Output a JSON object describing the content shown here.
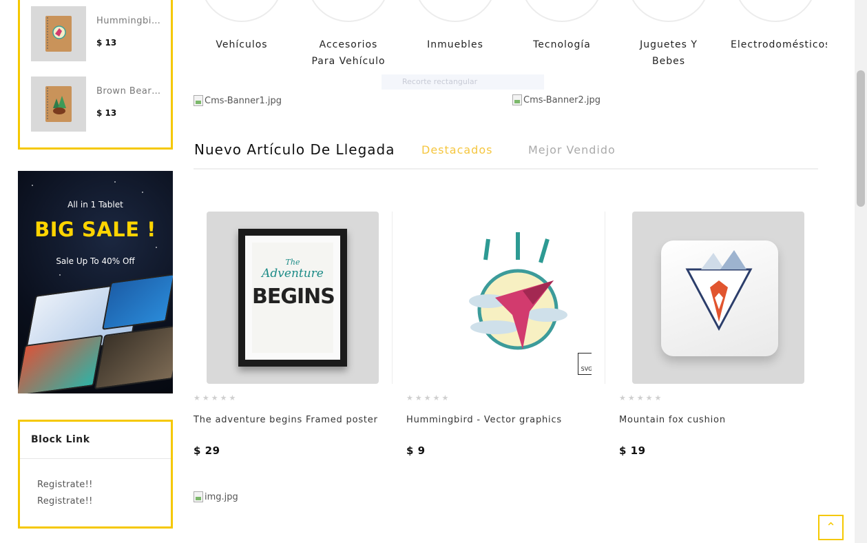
{
  "sidebar": {
    "mini_products": [
      {
        "name": "Hummingbird - Vector graphics",
        "price": "$ 13"
      },
      {
        "name": "Brown Bear - Vector graphics",
        "price": "$ 13"
      }
    ],
    "promo": {
      "kicker": "All in 1 Tablet",
      "title": "BIG SALE !",
      "subtitle": "Sale Up To 40% Off"
    },
    "block_link": {
      "title": "Block Link",
      "items": [
        "Registrate!!",
        "Registrate!!"
      ]
    }
  },
  "categories": [
    {
      "label": "Vehículos"
    },
    {
      "label": "Accesorios Para Vehículo"
    },
    {
      "label": "Inmuebles"
    },
    {
      "label": "Tecnología"
    },
    {
      "label": "Juguetes Y Bebes"
    },
    {
      "label": "Electrodomésticos"
    }
  ],
  "banners": {
    "banner1_alt": "Cms-Banner1.jpg",
    "banner2_alt": "Cms-Banner2.jpg",
    "bottom_alt": "img.jpg"
  },
  "faint_tool": "Recorte rectangular",
  "section": {
    "title": "Nuevo Artículo De Llegada",
    "tabs": [
      {
        "label": "Destacados",
        "color": "#f5c63f"
      },
      {
        "label": "Mejor Vendido",
        "color": "#aaaaaa"
      }
    ]
  },
  "products": [
    {
      "name": "The adventure begins Framed poster",
      "price": "$ 29",
      "stars": "★★★★★"
    },
    {
      "name": "Hummingbird - Vector graphics",
      "price": "$ 9",
      "stars": "★★★★★"
    },
    {
      "name": "Mountain fox cushion",
      "price": "$ 19",
      "stars": "★★★★★"
    }
  ],
  "poster": {
    "line1": "The",
    "line2": "Adventure",
    "line3": "BEGINS"
  },
  "svg_badge": "SVG",
  "back_to_top": "⌃",
  "colors": {
    "accent": "#f5c800",
    "tab_active": "#f5c63f"
  }
}
